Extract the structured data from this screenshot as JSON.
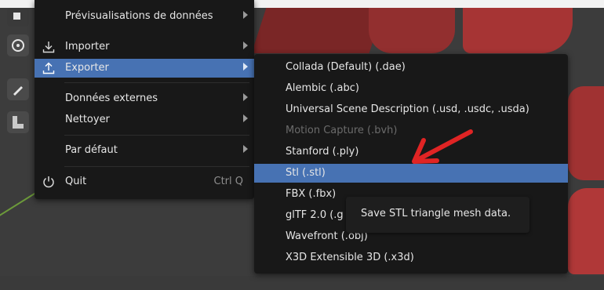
{
  "main_menu": {
    "items": [
      {
        "label": "Prévisualisations de données",
        "has_submenu": true
      },
      {
        "label": "Importer",
        "icon": "import-icon",
        "has_submenu": true
      },
      {
        "label": "Exporter",
        "icon": "export-icon",
        "has_submenu": true,
        "active": true
      },
      {
        "label": "Données externes",
        "has_submenu": true
      },
      {
        "label": "Nettoyer",
        "has_submenu": true
      },
      {
        "label": "Par défaut",
        "has_submenu": true
      },
      {
        "label": "Quit",
        "icon": "power-icon",
        "shortcut": "Ctrl Q"
      }
    ]
  },
  "export_submenu": {
    "items": [
      {
        "label": "Collada (Default) (.dae)"
      },
      {
        "label": "Alembic (.abc)"
      },
      {
        "label": "Universal Scene Description (.usd, .usdc, .usda)"
      },
      {
        "label": "Motion Capture (.bvh)",
        "disabled": true
      },
      {
        "label": "Stanford (.ply)"
      },
      {
        "label": "Stl (.stl)",
        "active": true
      },
      {
        "label": "FBX (.fbx)"
      },
      {
        "label": "glTF 2.0 (.g"
      },
      {
        "label": "Wavefront (.obj)"
      },
      {
        "label": "X3D Extensible 3D (.x3d)"
      }
    ]
  },
  "tooltip": {
    "text": "Save STL triangle mesh data."
  },
  "colors": {
    "menu_bg": "#181818",
    "highlight": "#4772b3",
    "annotation_arrow": "#e02424",
    "viewport_object": "#8e2d2d"
  }
}
